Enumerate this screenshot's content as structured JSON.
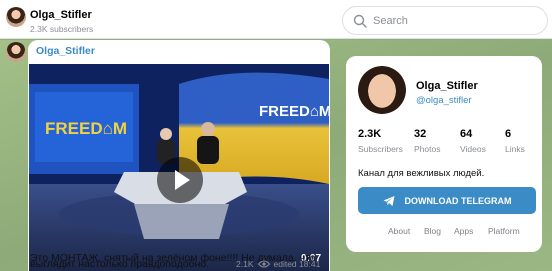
{
  "header": {
    "channel_name": "Olga_Stifler",
    "subscribers": "2.3K subscribers",
    "search_placeholder": "Search"
  },
  "post": {
    "author": "Olga_Stifler",
    "video": {
      "duration": "0:07",
      "logo_left": "FREED⌂M",
      "logo_right": "FREED⌂M"
    },
    "text_line1": "Это МОНТАЖ, снятый на зелёном фоне!!!! Не думала, что",
    "text_line2": "выглядит настолько правдоподобно.",
    "views": "2.1K",
    "edited_time": "edited 18:41"
  },
  "profile": {
    "name": "Olga_Stifler",
    "handle": "@olga_stifler",
    "stats": [
      {
        "value": "2.3K",
        "label": "Subscribers"
      },
      {
        "value": "32",
        "label": "Photos"
      },
      {
        "value": "64",
        "label": "Videos"
      },
      {
        "value": "6",
        "label": "Links"
      }
    ],
    "description": "Канал для вежливых людей.",
    "button_label": "DOWNLOAD TELEGRAM",
    "footer_links": [
      "About",
      "Blog",
      "Apps",
      "Platform"
    ]
  },
  "colors": {
    "accent": "#3a8bc6",
    "background": "#8fae7a"
  }
}
